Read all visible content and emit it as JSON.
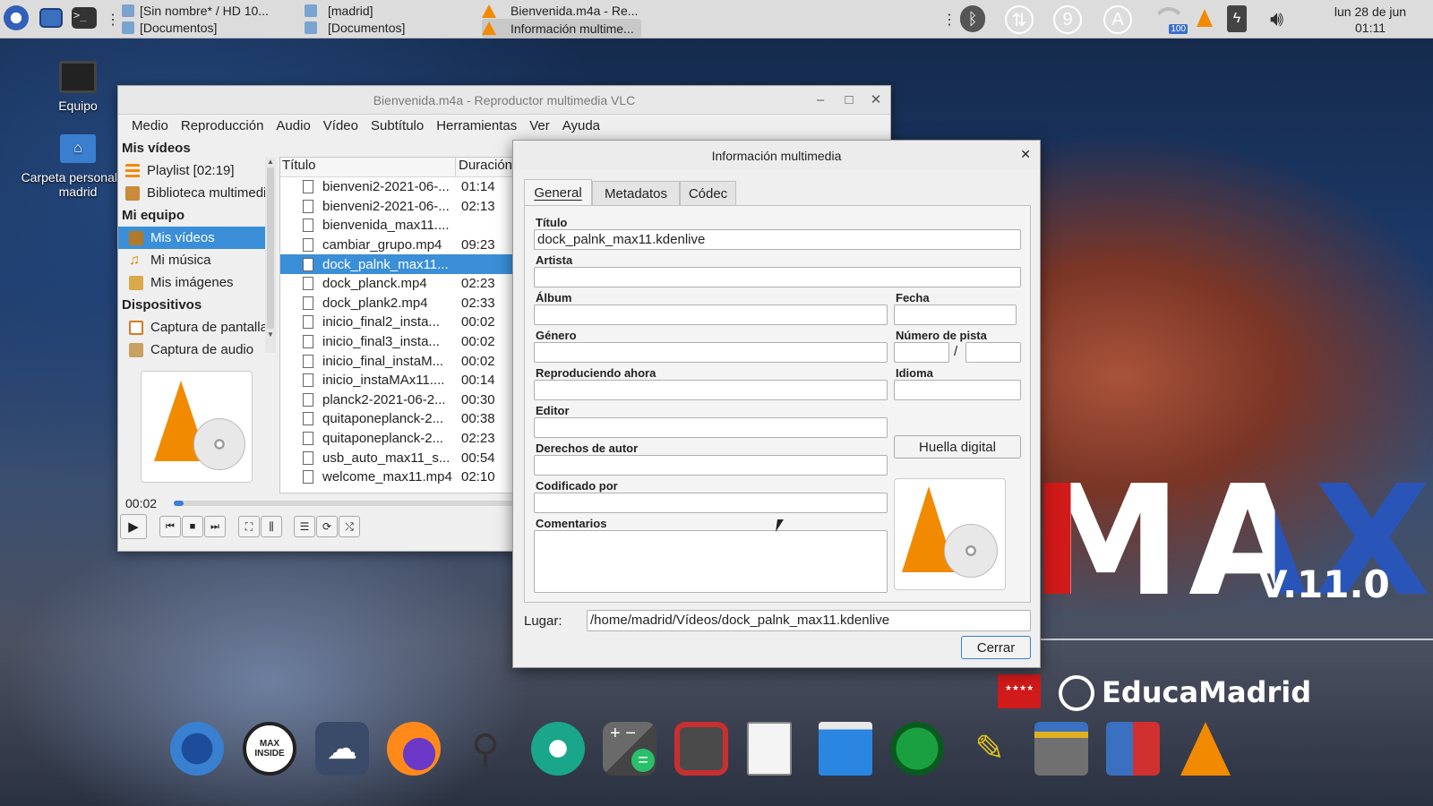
{
  "top_panel": {
    "tasks": [
      {
        "line1": "[Sin nombre* / HD 10...",
        "line2": "[Documentos]"
      },
      {
        "line1": "[madrid]",
        "line2": "[Documentos]"
      },
      {
        "line1": "Bienvenida.m4a - Re...",
        "line2": "Información multime..."
      }
    ],
    "tray": {
      "update_glyph": "⇅",
      "nine": "9",
      "a": "A",
      "wifi_badge": "100"
    },
    "clock": {
      "date": "lun 28 de jun",
      "time": "01:11"
    }
  },
  "desktop": {
    "icons": [
      {
        "label": "Equipo"
      },
      {
        "label": "Carpeta personal de madrid"
      }
    ]
  },
  "vlc": {
    "title": "Bienvenida.m4a - Reproductor multimedia VLC",
    "menu": [
      "Medio",
      "Reproducción",
      "Audio",
      "Vídeo",
      "Subtítulo",
      "Herramientas",
      "Ver",
      "Ayuda"
    ],
    "sidebar": {
      "h1": "Mis vídeos",
      "playlist": "Playlist [02:19]",
      "library": "Biblioteca multimedia",
      "h2": "Mi equipo",
      "my_videos": "Mis vídeos",
      "my_music": "Mi música",
      "my_images": "Mis imágenes",
      "h3": "Dispositivos",
      "screen_capture": "Captura de pantalla",
      "audio_capture": "Captura de audio"
    },
    "playlist_headers": {
      "title": "Título",
      "duration": "Duración"
    },
    "playlist": [
      {
        "title": "bienveni2-2021-06-...",
        "duration": "01:14"
      },
      {
        "title": "bienveni2-2021-06-...",
        "duration": "02:13"
      },
      {
        "title": "bienvenida_max11....",
        "duration": ""
      },
      {
        "title": "cambiar_grupo.mp4",
        "duration": "09:23"
      },
      {
        "title": "dock_palnk_max11...",
        "duration": ""
      },
      {
        "title": "dock_planck.mp4",
        "duration": "02:23"
      },
      {
        "title": "dock_plank2.mp4",
        "duration": "02:33"
      },
      {
        "title": "inicio_final2_insta...",
        "duration": "00:02"
      },
      {
        "title": "inicio_final3_insta...",
        "duration": "00:02"
      },
      {
        "title": "inicio_final_instaM...",
        "duration": "00:02"
      },
      {
        "title": "inicio_instaMAx11....",
        "duration": "00:14"
      },
      {
        "title": "planck2-2021-06-2...",
        "duration": "00:30"
      },
      {
        "title": "quitaponeplanck-2...",
        "duration": "00:38"
      },
      {
        "title": "quitaponeplanck-2...",
        "duration": "02:23"
      },
      {
        "title": "usb_auto_max11_s...",
        "duration": "00:54"
      },
      {
        "title": "welcome_max11.mp4",
        "duration": "02:10"
      }
    ],
    "time_elapsed": "00:02",
    "progress": 0.02
  },
  "media_info": {
    "title": "Información multimedia",
    "tabs": [
      "General",
      "Metadatos",
      "Códec"
    ],
    "labels": {
      "titulo": "Título",
      "artista": "Artista",
      "album": "Álbum",
      "fecha": "Fecha",
      "genero": "Género",
      "pista": "Número de pista",
      "reproduciendo": "Reproduciendo ahora",
      "idioma": "Idioma",
      "editor": "Editor",
      "derechos": "Derechos de autor",
      "codificado": "Codificado por",
      "comentarios": "Comentarios",
      "lugar": "Lugar:"
    },
    "values": {
      "titulo": "dock_palnk_max11.kdenlive",
      "track_separator": "/",
      "lugar": "/home/madrid/Vídeos/dock_palnk_max11.kdenlive"
    },
    "fingerprint_button": "Huella digital",
    "close_button": "Cerrar"
  },
  "wallpaper": {
    "logo": "MAX",
    "version": "V.11.0",
    "brand": "EducaMadrid"
  },
  "dock": {
    "apps": [
      "max-launcher",
      "max-inside",
      "cloud",
      "firefox",
      "search",
      "camera",
      "calculator",
      "screen-recorder",
      "text-editor",
      "file-window",
      "green-app",
      "paint",
      "archive",
      "presentation",
      "vlc"
    ],
    "max_inside_label": "MAX INSIDE"
  },
  "colors": {
    "selection": "#3a8fd8",
    "vlc_orange": "#f28a00",
    "max_red": "#d11a1a",
    "max_blue": "#2a55b8"
  }
}
